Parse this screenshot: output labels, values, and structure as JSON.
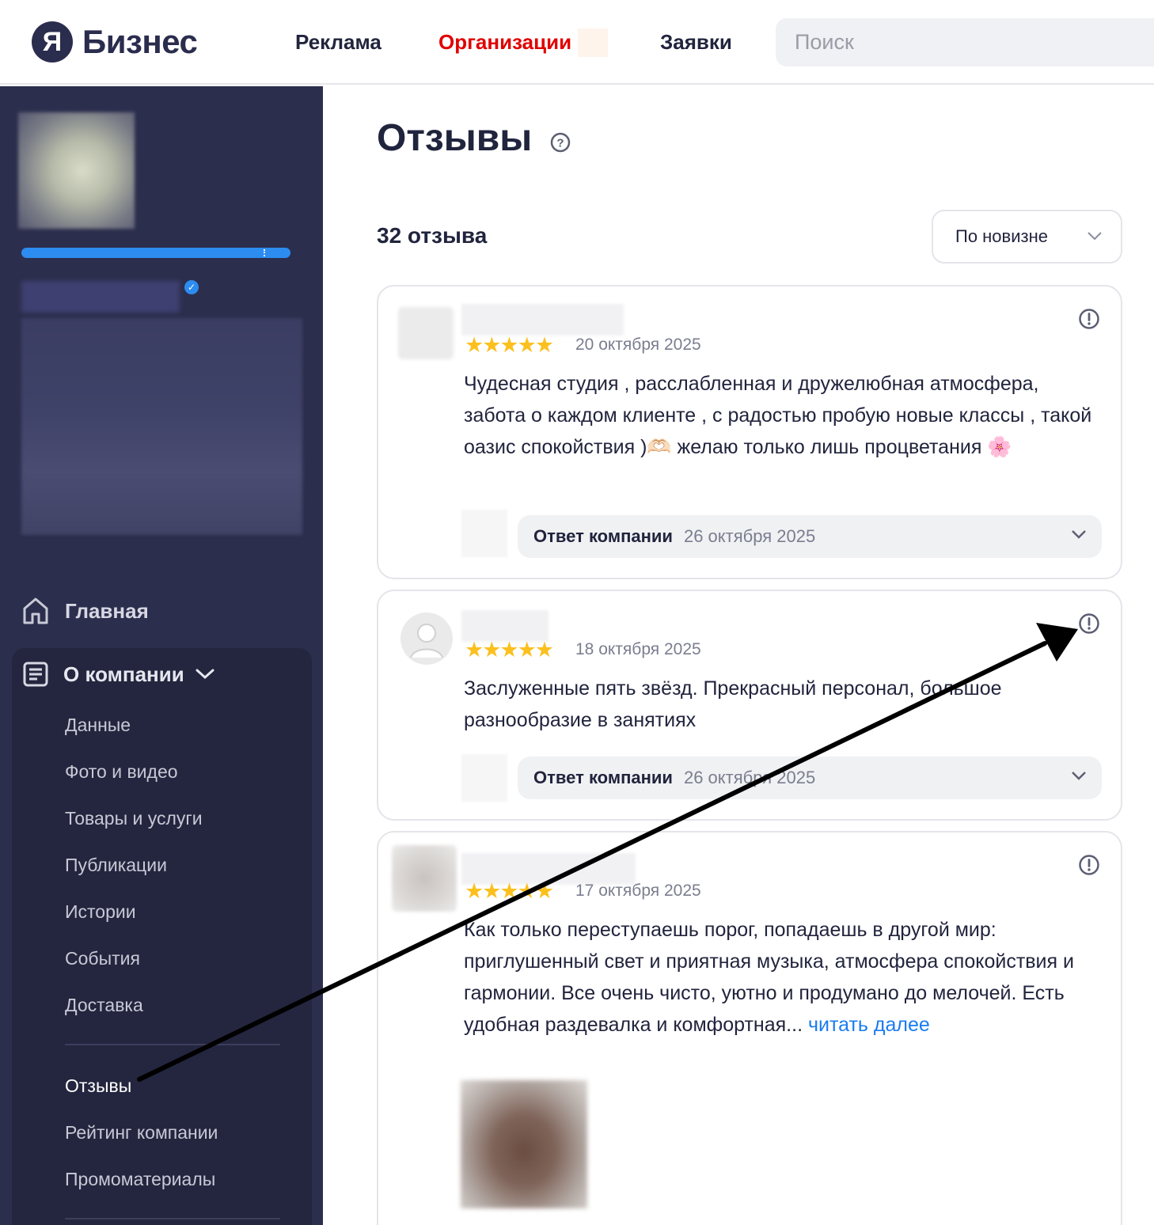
{
  "header": {
    "logo_mark": "Я",
    "logo_text": "Бизнес",
    "nav": [
      "Реклама",
      "Организации",
      "Заявки"
    ],
    "active_nav": "Организации",
    "search_placeholder": "Поиск"
  },
  "sidebar": {
    "main_item": "Главная",
    "company_section": "О компании",
    "items": [
      "Данные",
      "Фото и видео",
      "Товары и услуги",
      "Публикации",
      "Истории",
      "События",
      "Доставка"
    ],
    "items2": [
      "Отзывы",
      "Рейтинг компании",
      "Промоматериалы"
    ],
    "active_item": "Отзывы"
  },
  "main": {
    "title": "Отзывы",
    "count": "32 отзыва",
    "sort": "По новизне"
  },
  "reviews": [
    {
      "rating": 5,
      "stars": "★★★★★",
      "date": "20 октября 2025",
      "text": "Чудесная студия , расслабленная и дружелюбная атмосфера, забота о каждом клиенте , с радостью пробую новые классы , такой оазис спокойствия )🫶🏻 желаю только лишь процветания 🌸",
      "reply_label": "Ответ компании",
      "reply_date": "26 октября 2025"
    },
    {
      "rating": 5,
      "stars": "★★★★★",
      "date": "18 октября 2025",
      "text": "Заслуженные пять звёзд. Прекрасный персонал, большое разнообразие в занятиях",
      "reply_label": "Ответ компании",
      "reply_date": "26 октября 2025"
    },
    {
      "rating": 5,
      "stars": "★★★★★",
      "date": "17 октября 2025",
      "text": "Как только переступаешь порог, попадаешь в другой мир: приглушенный свет и приятная музыка, атмосфера спокойствия и гармонии. Все очень чисто, уютно и продумано до мелочей. Есть удобная раздевалка и комфортная... ",
      "more": "читать далее"
    }
  ],
  "colors": {
    "sidebar_bg": "#2c2e4d",
    "active_nav": "#e00000",
    "star": "#fcc01e",
    "link": "#1a7cf0",
    "progress": "#2c8cf0"
  },
  "icons": [
    "help-icon",
    "chevron-down-icon",
    "home-icon",
    "document-icon",
    "report-icon",
    "verified-icon"
  ]
}
